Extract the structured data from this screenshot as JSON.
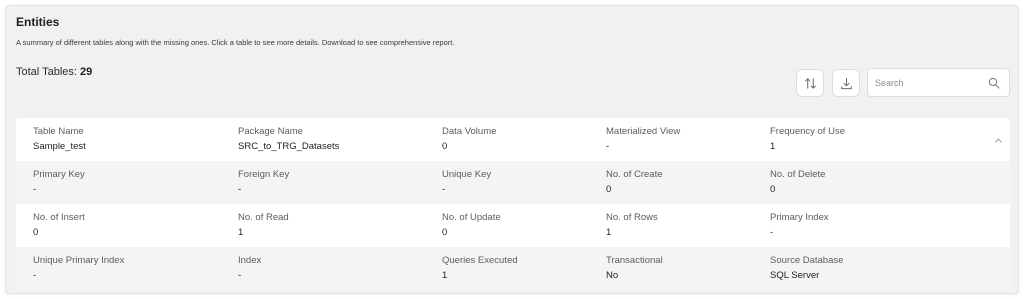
{
  "header": {
    "title": "Entities",
    "subtitle": "A summary of different tables along with the missing ones. Click a table to see more details. Download to see comprehensive report.",
    "total_label": "Total Tables: ",
    "total_value": "29"
  },
  "toolbar": {
    "sort_icon": "sort-icon",
    "download_icon": "download-icon",
    "search_placeholder": "Search",
    "search_value": ""
  },
  "entity": {
    "rows": [
      {
        "cells": [
          {
            "label": "Table Name",
            "value": "Sample_test"
          },
          {
            "label": "Package Name",
            "value": "SRC_to_TRG_Datasets"
          },
          {
            "label": "Data Volume",
            "value": "0"
          },
          {
            "label": "Materialized View",
            "value": "-"
          },
          {
            "label": "Frequency of Use",
            "value": "1"
          }
        ]
      },
      {
        "cells": [
          {
            "label": "Primary Key",
            "value": "-"
          },
          {
            "label": "Foreign Key",
            "value": "-"
          },
          {
            "label": "Unique Key",
            "value": "-"
          },
          {
            "label": "No. of Create",
            "value": "0"
          },
          {
            "label": "No. of Delete",
            "value": "0"
          }
        ]
      },
      {
        "cells": [
          {
            "label": "No. of Insert",
            "value": "0"
          },
          {
            "label": "No. of Read",
            "value": "1"
          },
          {
            "label": "No. of Update",
            "value": "0"
          },
          {
            "label": "No. of Rows",
            "value": "1"
          },
          {
            "label": "Primary Index",
            "value": "-"
          }
        ]
      },
      {
        "cells": [
          {
            "label": "Unique Primary Index",
            "value": "-"
          },
          {
            "label": "Index",
            "value": "-"
          },
          {
            "label": "Queries Executed",
            "value": "1"
          },
          {
            "label": "Transactional",
            "value": "No"
          },
          {
            "label": "Source Database",
            "value": "SQL Server"
          }
        ]
      }
    ],
    "collapse_icon": "chevron-up-icon"
  },
  "colors": {
    "panel_bg": "#f1f1f4",
    "card_bg": "#ffffff",
    "alt_row_bg": "#f4f4f6",
    "label_text": "#5c5c62",
    "value_text": "#1f1f1f"
  }
}
